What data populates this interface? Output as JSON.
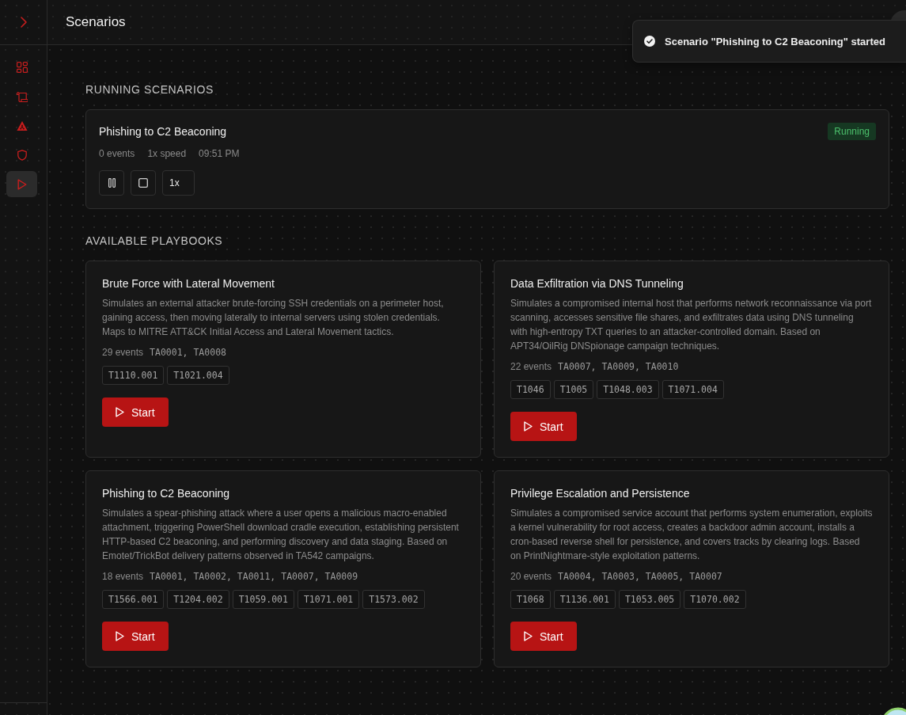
{
  "sidebar": {
    "items": [
      {
        "selected": false
      },
      {
        "selected": false
      },
      {
        "selected": false
      },
      {
        "selected": false
      },
      {
        "selected": true
      }
    ]
  },
  "header": {
    "title": "Scenarios"
  },
  "toast": {
    "message": "Scenario \"Phishing to C2 Beaconing\" started"
  },
  "running": {
    "heading": "RUNNING SCENARIOS",
    "scenarios": [
      {
        "name": "Phishing to C2 Beaconing",
        "status": "Running",
        "events": "0 events",
        "speed": "1x speed",
        "time": "09:51 PM",
        "speed_control": "1x"
      }
    ]
  },
  "playbooks": {
    "heading": "AVAILABLE PLAYBOOKS",
    "items": [
      {
        "name": "Brute Force with Lateral Movement",
        "description": "Simulates an external attacker brute-forcing SSH credentials on a perimeter host, gaining access, then moving laterally to internal servers using stolen credentials. Maps to MITRE ATT&CK Initial Access and Lateral Movement tactics.",
        "events": "29 events",
        "tactics": "TA0001, TA0008",
        "techniques": [
          "T1110.001",
          "T1021.004"
        ],
        "button": "Start"
      },
      {
        "name": "Data Exfiltration via DNS Tunneling",
        "description": "Simulates a compromised internal host that performs network reconnaissance via port scanning, accesses sensitive file shares, and exfiltrates data using DNS tunneling with high-entropy TXT queries to an attacker-controlled domain. Based on APT34/OilRig DNSpionage campaign techniques.",
        "events": "22 events",
        "tactics": "TA0007, TA0009, TA0010",
        "techniques": [
          "T1046",
          "T1005",
          "T1048.003",
          "T1071.004"
        ],
        "button": "Start"
      },
      {
        "name": "Phishing to C2 Beaconing",
        "description": "Simulates a spear-phishing attack where a user opens a malicious macro-enabled attachment, triggering PowerShell download cradle execution, establishing persistent HTTP-based C2 beaconing, and performing discovery and data staging. Based on Emotet/TrickBot delivery patterns observed in TA542 campaigns.",
        "events": "18 events",
        "tactics": "TA0001, TA0002, TA0011, TA0007, TA0009",
        "techniques": [
          "T1566.001",
          "T1204.002",
          "T1059.001",
          "T1071.001",
          "T1573.002"
        ],
        "button": "Start"
      },
      {
        "name": "Privilege Escalation and Persistence",
        "description": "Simulates a compromised service account that performs system enumeration, exploits a kernel vulnerability for root access, creates a backdoor admin account, installs a cron-based reverse shell for persistence, and covers tracks by clearing logs. Based on PrintNightmare-style exploitation patterns.",
        "events": "20 events",
        "tactics": "TA0004, TA0003, TA0005, TA0007",
        "techniques": [
          "T1068",
          "T1136.001",
          "T1053.005",
          "T1070.002"
        ],
        "button": "Start"
      }
    ]
  }
}
